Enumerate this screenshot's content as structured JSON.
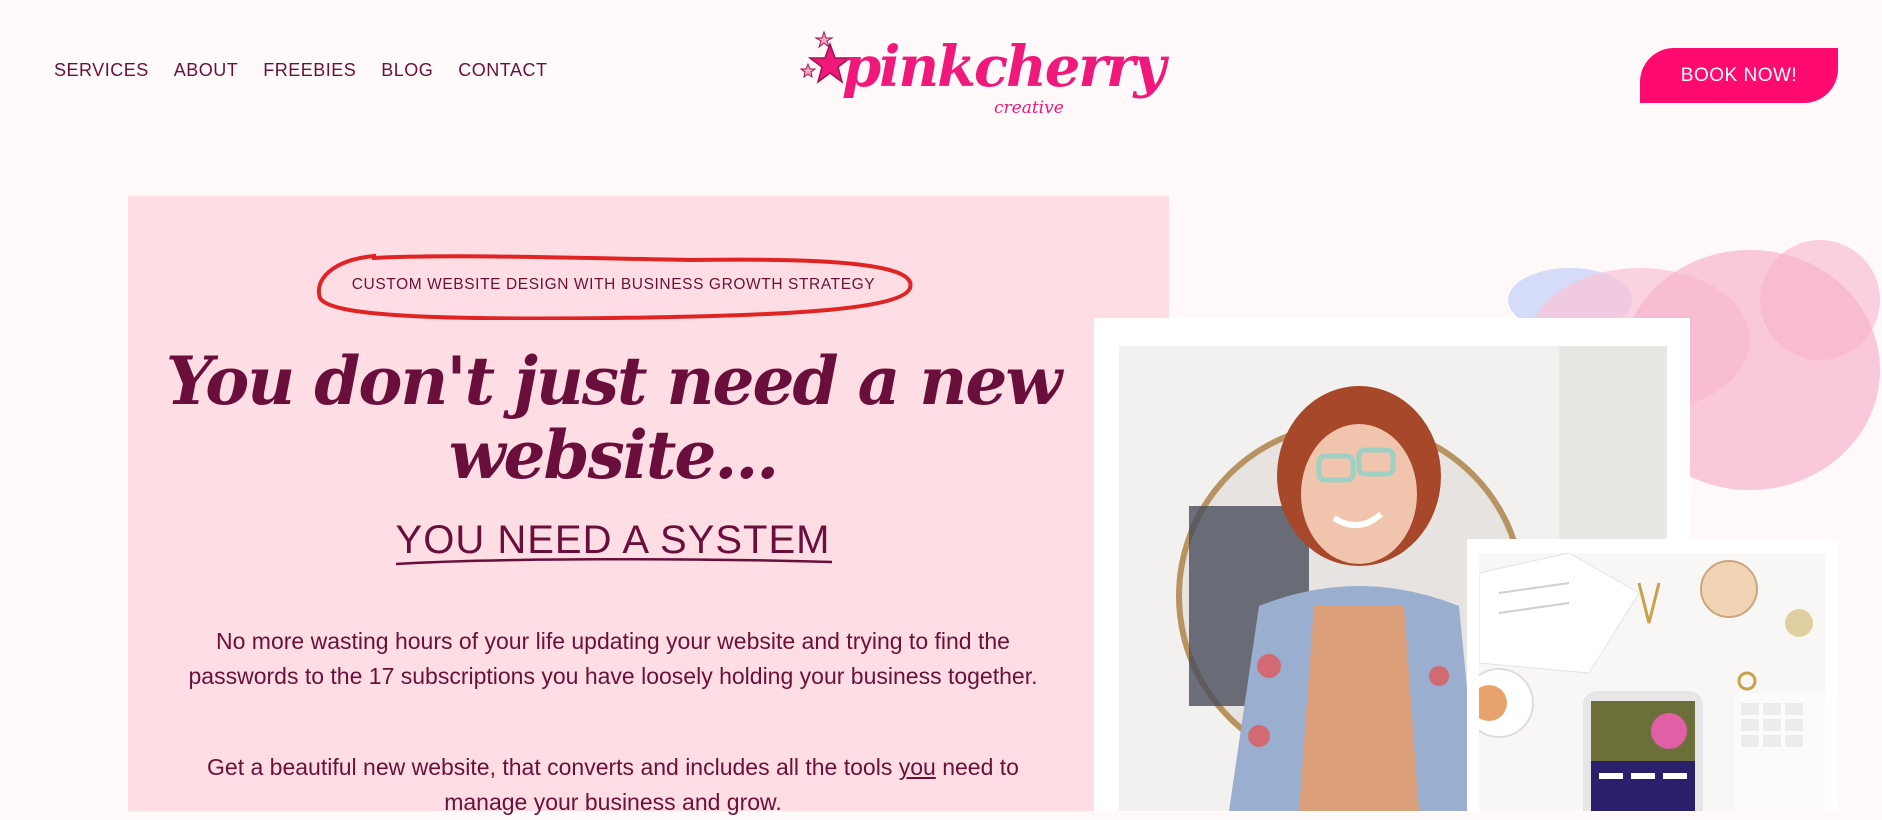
{
  "nav": {
    "items": [
      {
        "label": "SERVICES"
      },
      {
        "label": "ABOUT"
      },
      {
        "label": "FREEBIES"
      },
      {
        "label": "BLOG"
      },
      {
        "label": "CONTACT"
      }
    ]
  },
  "logo": {
    "word": "pinkcherry",
    "sub": "creative"
  },
  "header": {
    "book_label": "BOOK NOW!"
  },
  "hero": {
    "eyebrow": "CUSTOM WEBSITE DESIGN WITH BUSINESS GROWTH STRATEGY",
    "headline": "You don't just need a new website...",
    "subheadline": "YOU NEED A SYSTEM",
    "paragraph1": "No more wasting hours of your life updating your website and trying to find the passwords to the 17 subscriptions you have loosely holding your business together.",
    "paragraph2_before": "Get a beautiful new website, that converts and includes all the tools ",
    "paragraph2_emph": "you",
    "paragraph2_after": " need to manage your business and grow."
  },
  "colors": {
    "page_bg": "#fff9f9",
    "card_bg": "#fedde4",
    "accent": "#ff0a6e",
    "text": "#6a1039",
    "circle": "#e02424"
  }
}
